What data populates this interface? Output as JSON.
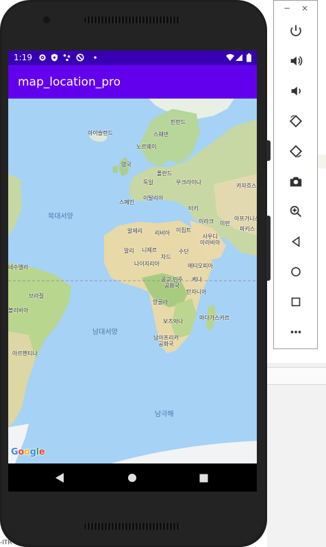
{
  "status_bar": {
    "time": "1:19",
    "background": "#3700b3"
  },
  "app_bar": {
    "title": "map_location_pro",
    "background": "#6200ee"
  },
  "map": {
    "google_logo": "Google",
    "ocean_labels": {
      "north_atlantic": "북대서양",
      "south_atlantic": "남대서양",
      "southern": "남극해"
    },
    "country_labels": {
      "iceland": "아이슬란드",
      "finland": "핀란드",
      "sweden": "스웨덴",
      "norway": "노르웨이",
      "uk": "영국",
      "poland": "폴란드",
      "germany": "독일",
      "ukraine": "우크라이나",
      "kazakhstan": "카자흐스탄",
      "spain": "스페인",
      "italy": "이탈리아",
      "turkey": "터키",
      "algeria": "알제리",
      "libya": "리비아",
      "egypt": "이집트",
      "iraq": "이라크",
      "iran": "이란",
      "afghanistan": "아프가니스",
      "pakistan": "파키스",
      "saudi": "사우디\n아라비아",
      "mali": "말리",
      "niger": "니제르",
      "chad": "차드",
      "sudan": "수단",
      "nigeria": "나이지리아",
      "ethiopia": "에티오피아",
      "venezuela": "네수엘라",
      "drc": "콩고 민주\n공화국",
      "kenya": "케냐",
      "tanzania": "탄자니아",
      "brazil": "브라질",
      "bolivia": "볼리비아",
      "angola": "앙골라",
      "botswana": "보츠와나",
      "madagascar": "마다가스카르",
      "south_africa": "남아프리카\n공화국",
      "argentina": "아르헨티나"
    }
  },
  "toolbar": {
    "minimize": "−",
    "close": "×",
    "buttons": [
      "power-icon",
      "volume-up-icon",
      "volume-down-icon",
      "rotate-left-icon",
      "rotate-right-icon",
      "camera-icon",
      "zoom-icon",
      "back-icon",
      "home-icon",
      "overview-icon",
      "more-icon"
    ]
  },
  "corner_text": "-ITR"
}
